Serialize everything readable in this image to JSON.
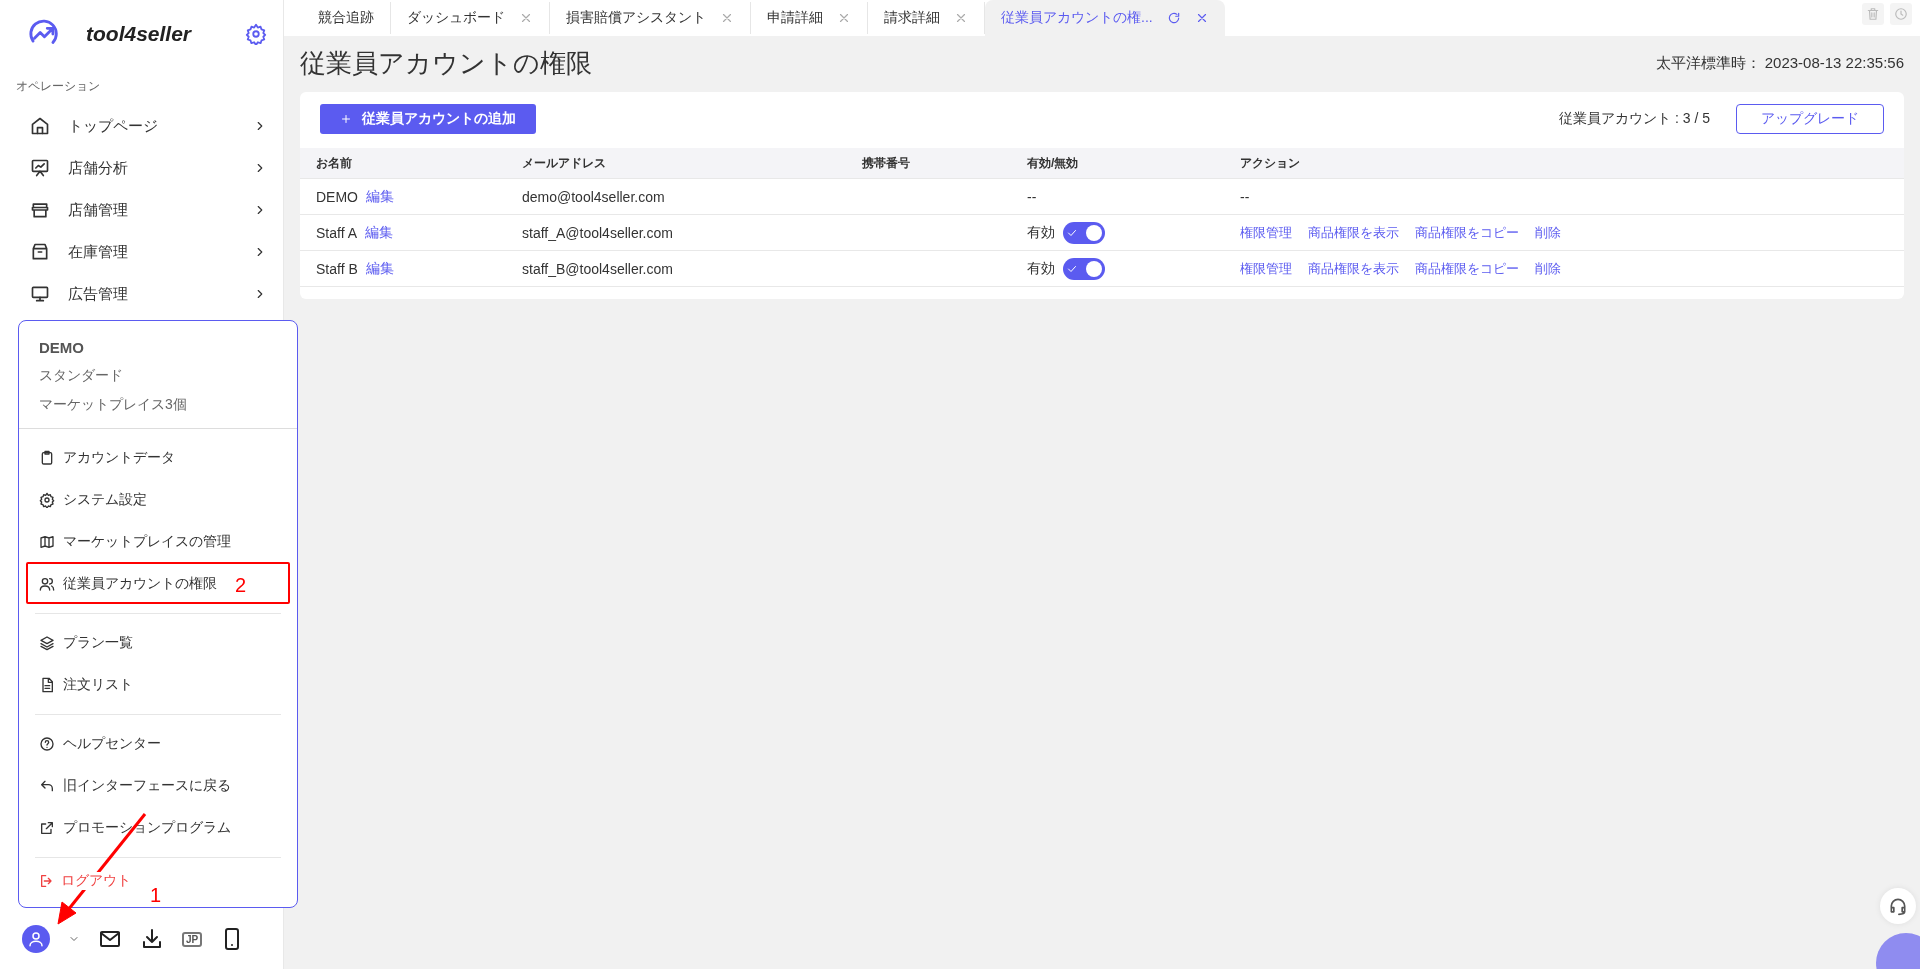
{
  "sidebar": {
    "logo": "tool4seller",
    "section": "オペレーション",
    "items": [
      {
        "label": "トップページ"
      },
      {
        "label": "店舗分析"
      },
      {
        "label": "店舗管理"
      },
      {
        "label": "在庫管理"
      },
      {
        "label": "広告管理"
      }
    ],
    "bottom_bar": {
      "language_badge": "JP"
    }
  },
  "tabs": [
    {
      "label": "競合追跡",
      "selected": false,
      "closable": false
    },
    {
      "label": "ダッシュボード",
      "selected": false,
      "closable": true
    },
    {
      "label": "損害賠償アシスタント",
      "selected": false,
      "closable": true
    },
    {
      "label": "申請詳細",
      "selected": false,
      "closable": true
    },
    {
      "label": "請求詳細",
      "selected": false,
      "closable": true
    },
    {
      "label": "従業員アカウントの権...",
      "selected": true,
      "closable": true
    }
  ],
  "header": {
    "title": "従業員アカウントの権限",
    "timezone": "太平洋標準時： 2023-08-13 22:35:56"
  },
  "toolbar": {
    "add_button": "従業員アカウントの追加",
    "account_count": "従業員アカウント : 3 / 5",
    "upgrade_button": "アップグレード"
  },
  "table": {
    "columns": [
      "お名前",
      "メールアドレス",
      "携帯番号",
      "有効/無効",
      "アクション"
    ],
    "rows": [
      {
        "kind": "owner",
        "name": "DEMO",
        "edit": "編集",
        "email": "demo@tool4seller.com",
        "status_text": "--",
        "action_text": "--"
      },
      {
        "kind": "staff",
        "name": "Staff A",
        "edit": "編集",
        "email": "staff_A@tool4seller.com",
        "status_text": "有効",
        "enabled": true,
        "actions": [
          "権限管理",
          "商品権限を表示",
          "商品権限をコピー",
          "削除"
        ]
      },
      {
        "kind": "staff",
        "name": "Staff B",
        "edit": "編集",
        "email": "staff_B@tool4seller.com",
        "status_text": "有効",
        "enabled": true,
        "actions": [
          "権限管理",
          "商品権限を表示",
          "商品権限をコピー",
          "削除"
        ]
      }
    ]
  },
  "user_menu": {
    "name": "DEMO",
    "plan": "スタンダード",
    "marketplaces": "マーケットプレイス3個",
    "sections": [
      {
        "items": [
          "アカウントデータ",
          "システム設定",
          "マーケットプレイスの管理",
          "従業員アカウントの権限"
        ]
      },
      {
        "items": [
          "プラン一覧",
          "注文リスト"
        ]
      },
      {
        "items": [
          "ヘルプセンター",
          "旧インターフェースに戻る",
          "プロモーションプログラム"
        ]
      }
    ],
    "logout": "ログアウト"
  },
  "annotations": {
    "box_number": "2",
    "arrow_number": "1"
  }
}
